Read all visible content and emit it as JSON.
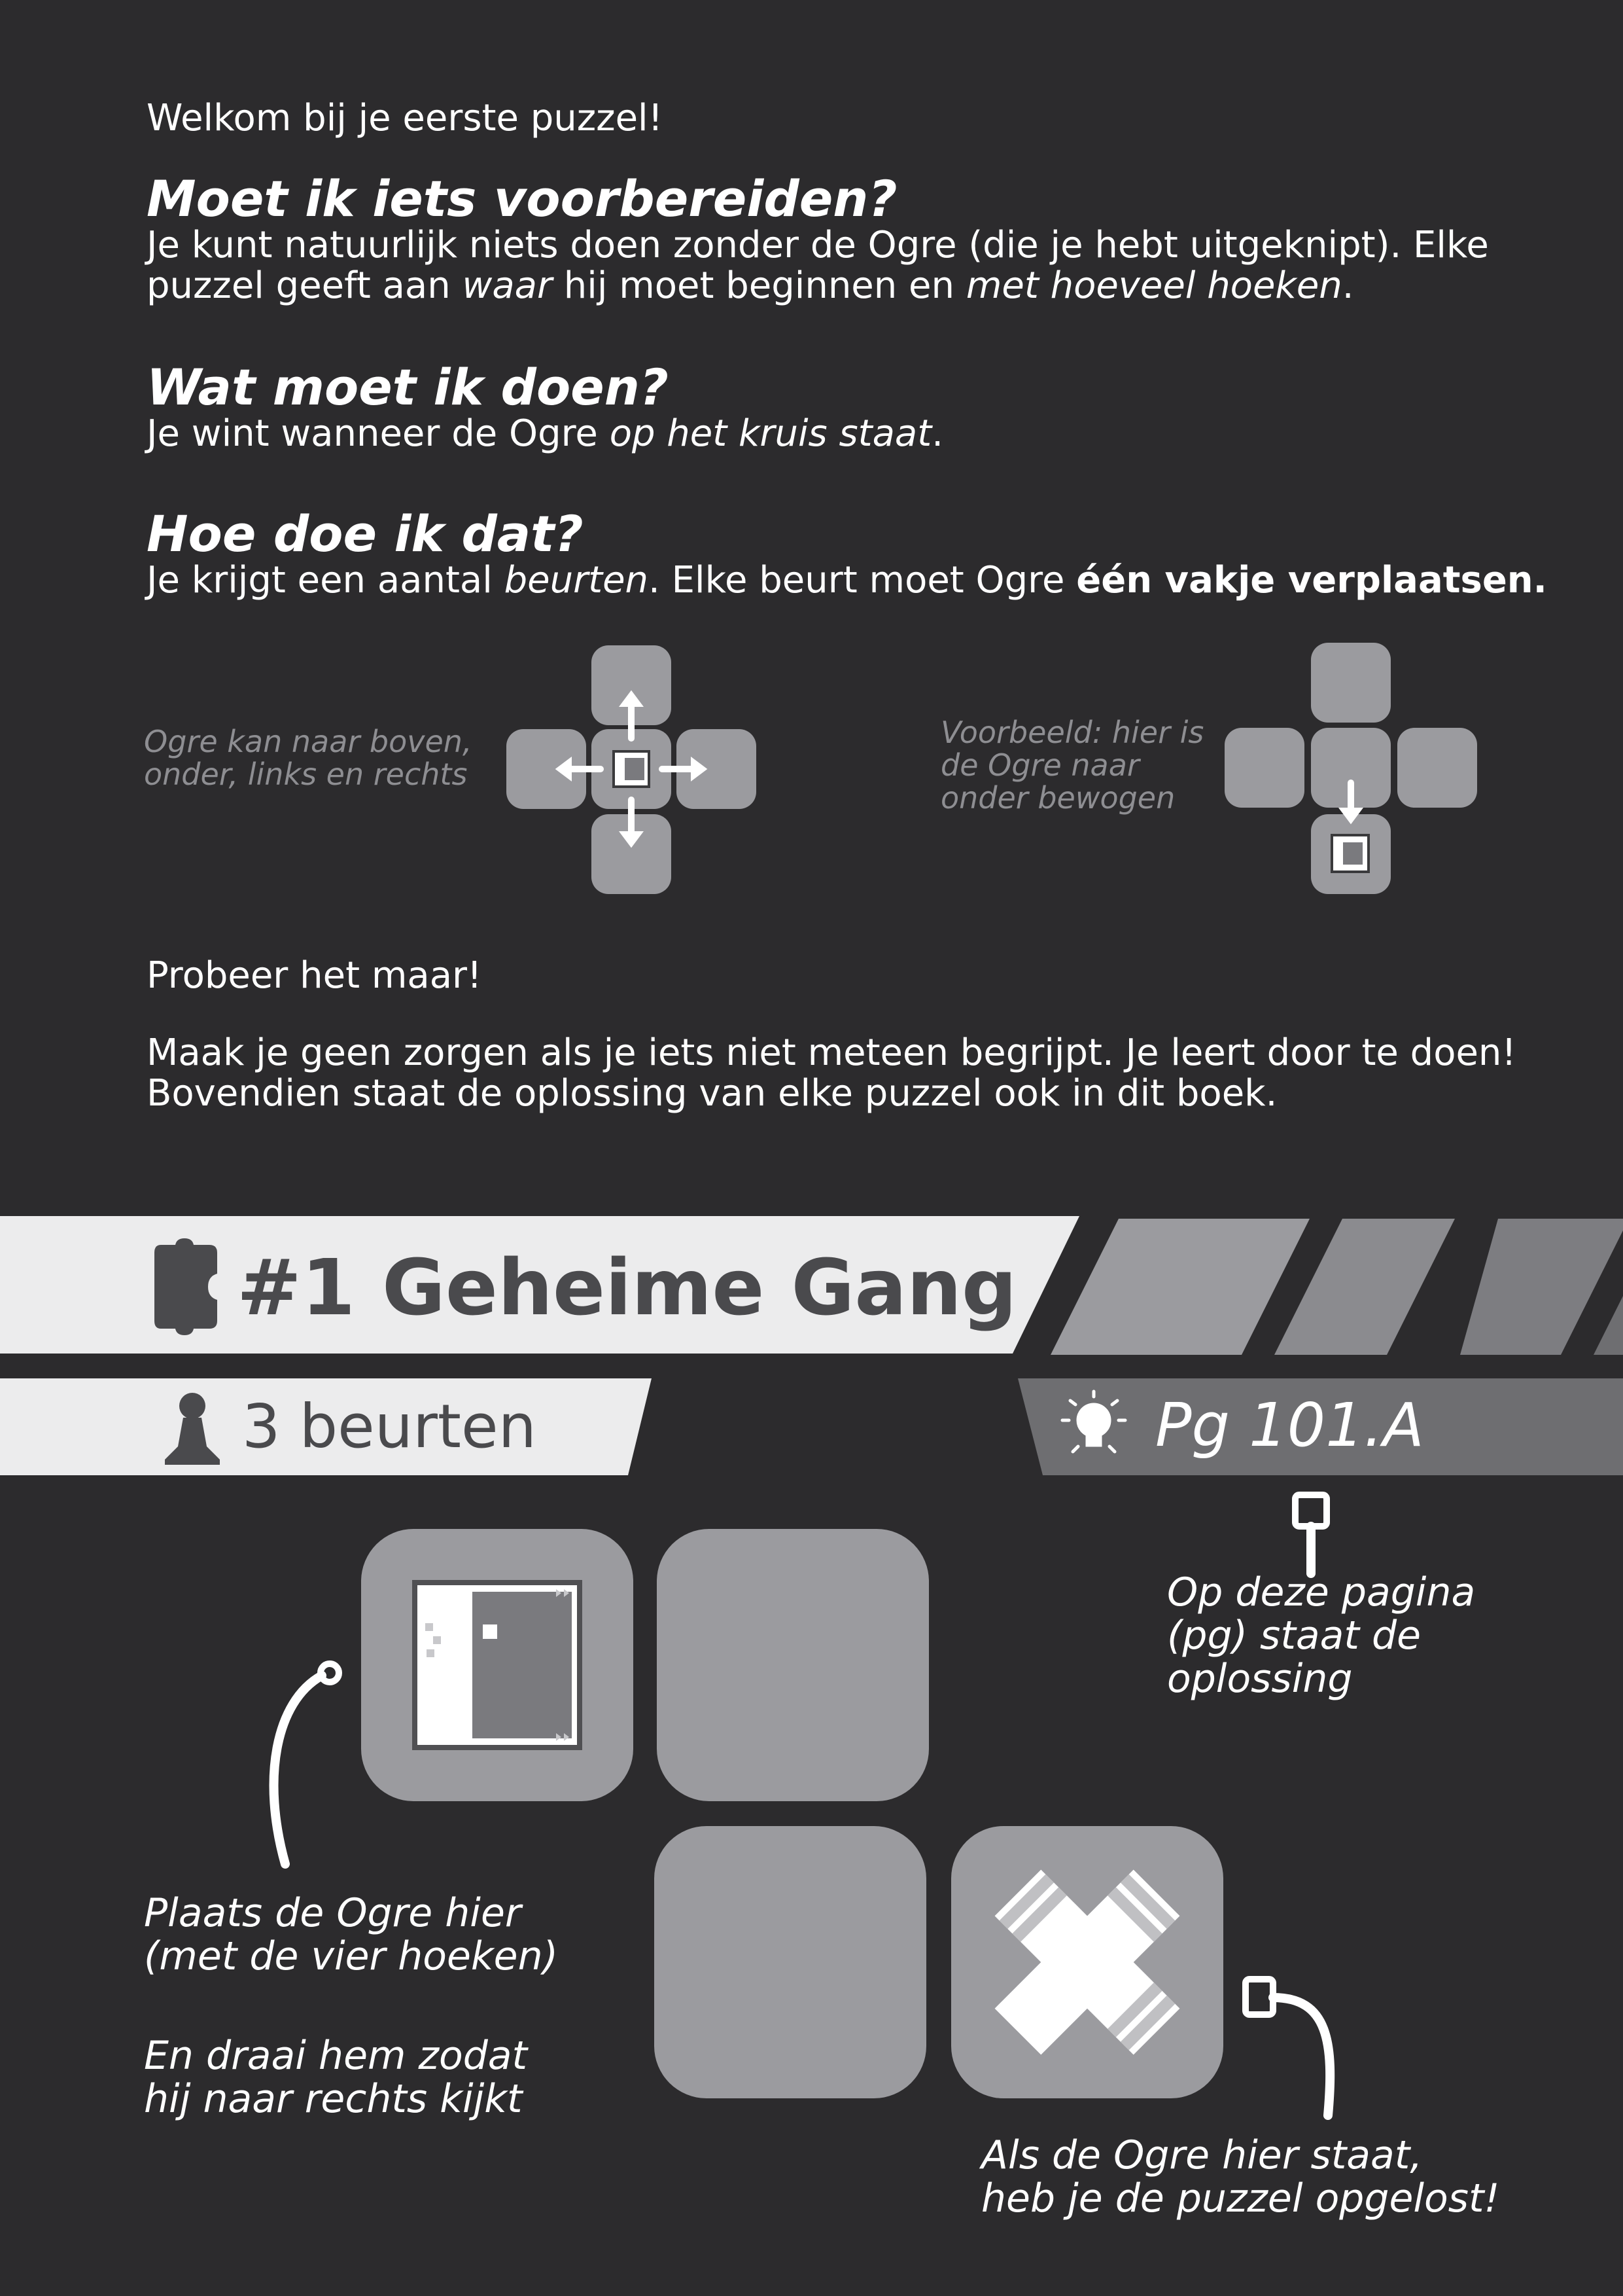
{
  "intro": {
    "welcome": "Welkom bij je eerste puzzel!",
    "q1_title": "Moet ik iets voorbereiden?",
    "q1_line1": "Je kunt natuurlijk niets doen zonder de Ogre (die je hebt uitgeknipt). Elke",
    "q1_line2_a": "puzzel geeft aan ",
    "q1_line2_b": "waar",
    "q1_line2_c": " hij moet beginnen en ",
    "q1_line2_d": "met hoeveel hoeken",
    "q1_line2_e": ".",
    "q2_title": "Wat moet ik doen?",
    "q2_a": "Je wint wanneer de Ogre ",
    "q2_b": "op het kruis staat",
    "q2_c": ".",
    "q3_title": "Hoe doe ik dat?",
    "q3_a": "Je krijgt een aantal ",
    "q3_b": "beurten",
    "q3_c": ". Elke beurt moet Ogre ",
    "q3_d": "één vakje verplaatsen.",
    "note_left_1": "Ogre kan naar boven,",
    "note_left_2": "onder, links en rechts",
    "note_right_1": "Voorbeeld: hier is",
    "note_right_2": "de Ogre naar",
    "note_right_3": "onder bewogen",
    "try": "Probeer het maar!",
    "help_1": "Maak je geen zorgen als je iets niet meteen begrijpt. Je leert door te doen!",
    "help_2": "Bovendien staat de oplossing van elke puzzel ook in dit boek."
  },
  "puzzle": {
    "title": "#1 Geheime Gang",
    "turns": "3 beurten",
    "solution_ref": "Pg 101.A",
    "callout_solution_1": "Op deze pagina",
    "callout_solution_2": "(pg) staat de",
    "callout_solution_3": "oplossing",
    "callout_place_1": "Plaats de Ogre hier",
    "callout_place_2": "(met de vier hoeken)",
    "callout_turn_1": "En draai hem zodat",
    "callout_turn_2": "hij naar rechts kijkt",
    "callout_goal_1": "Als de Ogre hier staat,",
    "callout_goal_2": "heb je de puzzel opgelost!"
  },
  "icons": [
    "puzzle-piece-icon",
    "pawn-icon",
    "lightbulb-icon",
    "arrow-up-icon",
    "arrow-down-icon",
    "arrow-left-icon",
    "arrow-right-icon",
    "ogre-piece-icon",
    "goal-cross-icon"
  ],
  "colors": {
    "background": "#2c2b2d",
    "tile": "#9b9b9f",
    "banner_light": "#ececed",
    "banner_dark": "#6e6e71",
    "note_gray": "#8e8e92"
  }
}
